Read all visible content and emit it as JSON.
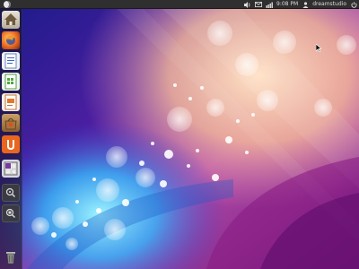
{
  "top_panel": {
    "session_icon": "ubuntu-session-icon",
    "indicators": [
      "volume-icon",
      "mail-icon",
      "network-icon"
    ],
    "clock": "9:08 PM",
    "user_name": "dreamstudio",
    "power_icon": "power-icon"
  },
  "launcher": {
    "items": [
      "home-folder-icon",
      "firefox-icon",
      "writer-icon",
      "calc-icon",
      "impress-icon",
      "software-center-icon",
      "ubuntu-one-icon",
      "workspace-switcher-icon",
      "applications-lens-icon",
      "files-lens-icon",
      "trash-icon"
    ]
  },
  "colors": {
    "panel": "#2f2f2f",
    "launcher_bg": "#14141e",
    "accent_orange": "#e9661f"
  }
}
